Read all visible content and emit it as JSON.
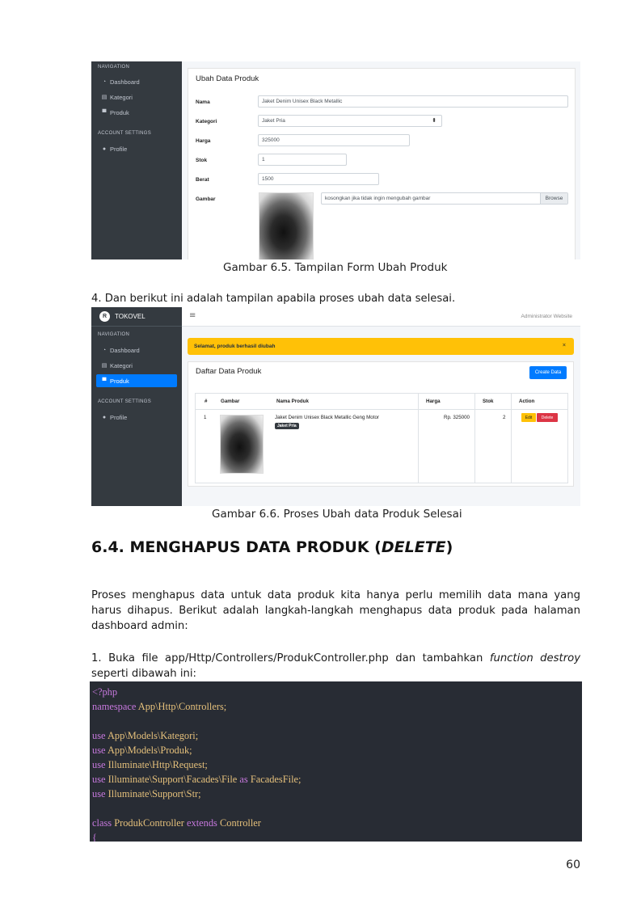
{
  "screenshot1": {
    "sidebar": {
      "nav_header": "NAVIGATION",
      "items": [
        {
          "label": "Dashboard",
          "icon": "tachometer-icon"
        },
        {
          "label": "Kategori",
          "icon": "list-icon"
        },
        {
          "label": "Produk",
          "icon": "tshirt-icon"
        }
      ],
      "account_header": "ACCOUNT SETTINGS",
      "account_items": [
        {
          "label": "Profile",
          "icon": "user-icon"
        }
      ]
    },
    "form": {
      "title": "Ubah Data Produk",
      "fields": {
        "nama": {
          "label": "Nama",
          "value": "Jaket Denim Unisex Black Metallic"
        },
        "kategori": {
          "label": "Kategori",
          "value": "Jaket Pria"
        },
        "harga": {
          "label": "Harga",
          "value": "325000"
        },
        "stok": {
          "label": "Stok",
          "value": "1"
        },
        "berat": {
          "label": "Berat",
          "value": "1500"
        },
        "gambar": {
          "label": "Gambar",
          "placeholder": "kosongkan jika tidak ingin mengubah gambar",
          "browse": "Browse"
        }
      }
    },
    "caption": "Gambar 6.5. Tampilan Form Ubah Produk"
  },
  "step4_text": "4. Dan berikut ini adalah tampilan apabila proses ubah data selesai.",
  "screenshot2": {
    "brand": "TOKOVEL",
    "brand_logo": "R",
    "topbar_user": "Administrator Website",
    "sidebar": {
      "nav_header": "NAVIGATION",
      "items": [
        {
          "label": "Dashboard",
          "icon": "tachometer-icon"
        },
        {
          "label": "Kategori",
          "icon": "list-icon"
        },
        {
          "label": "Produk",
          "icon": "tshirt-icon",
          "active": true
        }
      ],
      "account_header": "ACCOUNT SETTINGS",
      "account_items": [
        {
          "label": "Profile",
          "icon": "user-icon"
        }
      ]
    },
    "alert": {
      "message": "Selamat, produk berhasil diubah",
      "close": "×"
    },
    "list": {
      "title": "Daftar Data Produk",
      "create_button": "Create Data",
      "columns": [
        "#",
        "Gambar",
        "Nama Produk",
        "Harga",
        "Stok",
        "Action"
      ],
      "rows": [
        {
          "no": "1",
          "nama": "Jaket Denim Unisex Black Metallic Geng Motor",
          "kategori": "Jaket Pria",
          "harga": "Rp. 325000",
          "stok": "2",
          "edit": "Edit",
          "delete": "Delete"
        }
      ]
    },
    "caption": "Gambar 6.6. Proses Ubah data Produk Selesai"
  },
  "section": {
    "heading_main": "6.4. MENGHAPUS DATA PRODUK (",
    "heading_em": "DELETE",
    "heading_end": ")",
    "paragraph": "Proses menghapus data untuk data produk kita hanya perlu memilih data mana yang harus dihapus. Berikut adalah langkah-langkah menghapus data produk pada halaman dashboard admin:",
    "step1_a": "1. Buka file app/Http/Controllers/ProdukController.php dan tambahkan ",
    "step1_em": "function destroy",
    "step1_b": " seperti dibawah ini:"
  },
  "code": {
    "l1": "<?php",
    "l2_kw": "namespace",
    "l2_tx": " App\\Http\\Controllers;",
    "l4_tx": " App\\Models\\Kategori;",
    "l5_tx": " App\\Models\\Produk;",
    "l6_tx": " Illuminate\\Http\\Request;",
    "l7_tx": " Illuminate\\Support\\Facades\\File ",
    "l7_as": "as",
    "l7_tx2": " FacadesFile;",
    "l8_tx": " Illuminate\\Support\\Str;",
    "use_kw": "use",
    "l10_kw": "class",
    "l10_tx": " ProdukController ",
    "l10_kw2": "extends",
    "l10_tx2": " Controller",
    "l11": "{"
  },
  "page_number": "60"
}
